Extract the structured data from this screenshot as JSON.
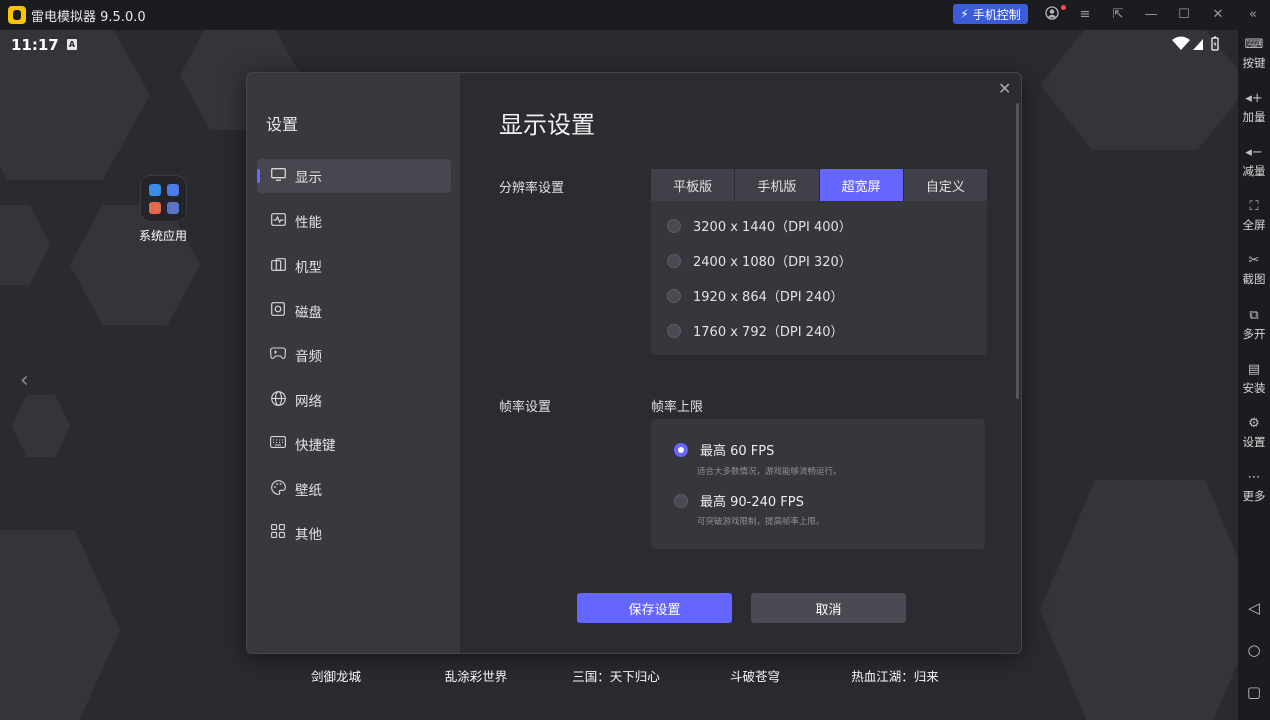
{
  "titlebar": {
    "title": "雷电模拟器 9.5.0.0",
    "phone_control": "手机控制"
  },
  "statusbar": {
    "time": "11:17",
    "badge": "A"
  },
  "desktop": {
    "system_app_label": "系统应用",
    "games": [
      "剑御龙城",
      "乱涂彩世界",
      "三国：天下归心",
      "斗破苍穹",
      "热血江湖：归来"
    ]
  },
  "right_sidebar": {
    "items": [
      "按键",
      "加量",
      "减量",
      "全屏",
      "截图",
      "多开",
      "安装",
      "设置",
      "更多"
    ]
  },
  "dialog": {
    "title": "设置",
    "nav": [
      {
        "label": "显示",
        "icon": "monitor-icon"
      },
      {
        "label": "性能",
        "icon": "performance-icon"
      },
      {
        "label": "机型",
        "icon": "device-icon"
      },
      {
        "label": "磁盘",
        "icon": "disk-icon"
      },
      {
        "label": "音频",
        "icon": "gamepad-icon"
      },
      {
        "label": "网络",
        "icon": "globe-icon"
      },
      {
        "label": "快捷键",
        "icon": "keyboard-icon"
      },
      {
        "label": "壁纸",
        "icon": "palette-icon"
      },
      {
        "label": "其他",
        "icon": "grid-icon"
      }
    ],
    "active_nav": 0,
    "heading": "显示设置",
    "resolution": {
      "label": "分辨率设置",
      "tabs": [
        "平板版",
        "手机版",
        "超宽屏",
        "自定义"
      ],
      "active_tab": 2,
      "options": [
        "3200 x 1440（DPI 400）",
        "2400 x 1080（DPI 320）",
        "1920 x 864（DPI 240）",
        "1760 x 792（DPI 240）"
      ]
    },
    "framerate": {
      "label": "帧率设置",
      "sub_label": "帧率上限",
      "options": [
        {
          "title": "最高 60 FPS",
          "desc": "适合大多数情况，游戏能够流畅运行。",
          "selected": true
        },
        {
          "title": "最高 90-240 FPS",
          "desc": "可突破游戏限制，提高帧率上限。",
          "selected": false
        }
      ]
    },
    "save_label": "保存设置",
    "cancel_label": "取消"
  },
  "colors": {
    "accent": "#6565ff",
    "phone_control_bg": "#3b5bd9"
  }
}
